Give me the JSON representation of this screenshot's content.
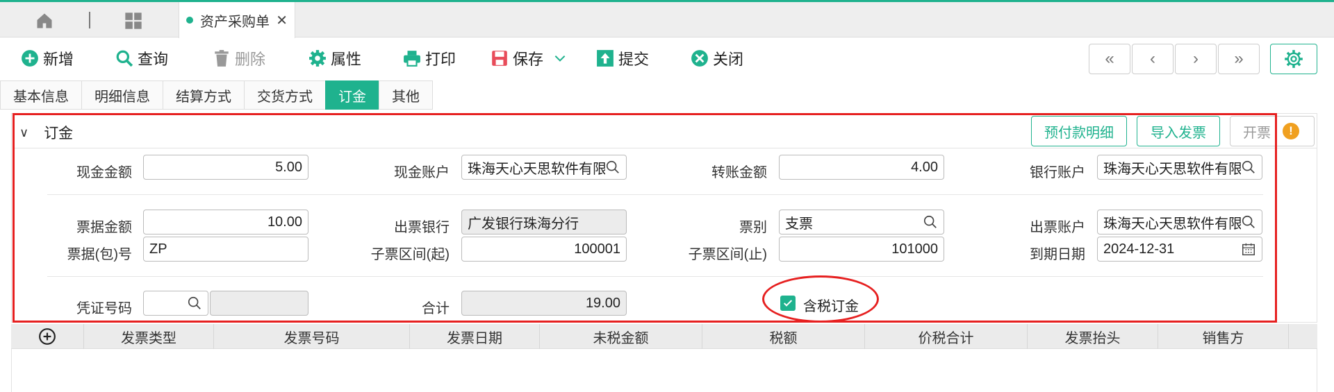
{
  "tabbar": {
    "doc_tab_label": "资产采购单"
  },
  "toolbar": {
    "add": "新增",
    "query": "查询",
    "delete": "删除",
    "properties": "属性",
    "print": "打印",
    "save": "保存",
    "submit": "提交",
    "close": "关闭"
  },
  "subtabs": [
    "基本信息",
    "明细信息",
    "结算方式",
    "交货方式",
    "订金",
    "其他"
  ],
  "section": {
    "title": "订金",
    "btn_prepay": "预付款明细",
    "btn_import": "导入发票",
    "btn_invoice": "开票"
  },
  "form": {
    "cash_amount_label": "现金金额",
    "cash_amount": "5.00",
    "cash_account_label": "现金账户",
    "cash_account": "珠海天心天思软件有限",
    "transfer_amount_label": "转账金额",
    "transfer_amount": "4.00",
    "bank_account_label": "银行账户",
    "bank_account": "珠海天心天思软件有限",
    "bill_amount_label": "票据金额",
    "bill_amount": "10.00",
    "issue_bank_label": "出票银行",
    "issue_bank": "广发银行珠海分行",
    "bill_type_label": "票别",
    "bill_type": "支票",
    "issue_account_label": "出票账户",
    "issue_account": "珠海天心天思软件有限",
    "bill_no_label": "票据(包)号",
    "bill_no": "ZP",
    "sub_from_label": "子票区间(起)",
    "sub_from": "100001",
    "sub_to_label": "子票区间(止)",
    "sub_to": "101000",
    "due_date_label": "到期日期",
    "due_date": "2024-12-31",
    "voucher_label": "凭证号码",
    "voucher_no": "",
    "voucher_extra": "",
    "total_label": "合计",
    "total": "19.00",
    "tax_included_label": "含税订金",
    "tax_included": true
  },
  "grid": {
    "columns": [
      "发票类型",
      "发票号码",
      "发票日期",
      "未税金额",
      "税额",
      "价税合计",
      "发票抬头",
      "销售方"
    ]
  },
  "colors": {
    "accent": "#1fb28e",
    "highlight": "#e62020",
    "warning": "#f0a020"
  }
}
